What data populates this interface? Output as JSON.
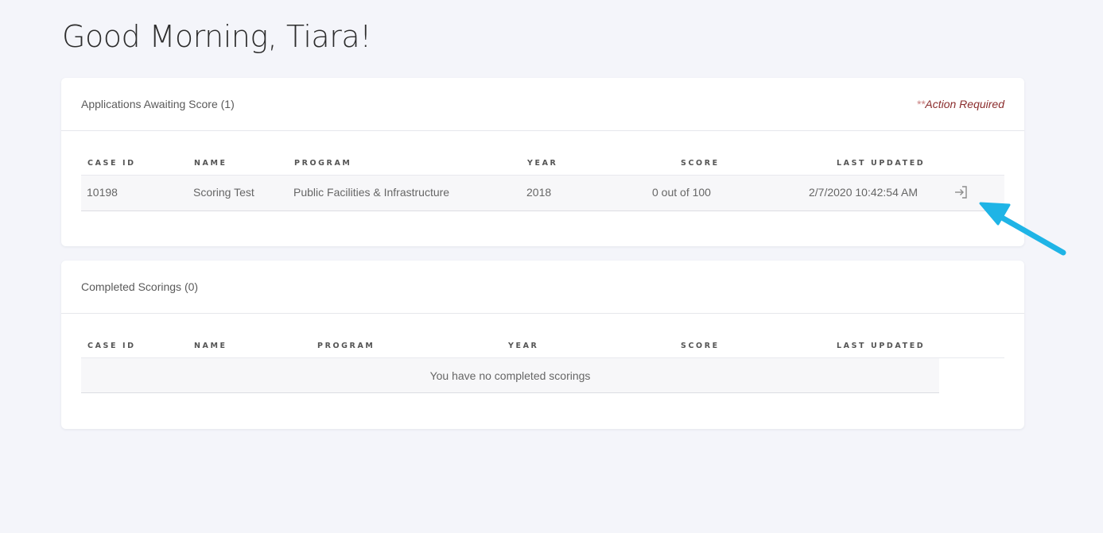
{
  "greeting": "Good Morning, Tiara!",
  "awaiting": {
    "title": "Applications Awaiting Score (1)",
    "action_stars": "**",
    "action_text": "Action Required",
    "columns": [
      "CASE ID",
      "NAME",
      "PROGRAM",
      "YEAR",
      "SCORE",
      "LAST UPDATED"
    ],
    "rows": [
      {
        "case_id": "10198",
        "name": "Scoring Test",
        "program": "Public Facilities & Infrastructure",
        "year": "2018",
        "score": "0 out of 100",
        "last_updated": "2/7/2020 10:42:54 AM"
      }
    ]
  },
  "completed": {
    "title": "Completed Scorings (0)",
    "columns": [
      "CASE ID",
      "NAME",
      "PROGRAM",
      "YEAR",
      "SCORE",
      "LAST UPDATED"
    ],
    "empty_message": "You have no completed scorings"
  },
  "colors": {
    "background": "#f4f5fa",
    "action_required": "#8b2d2d",
    "annotation_arrow": "#1fb4e6"
  },
  "icons": {
    "open_row": "sign-in-icon",
    "annotation": "arrow-pointer-icon"
  }
}
